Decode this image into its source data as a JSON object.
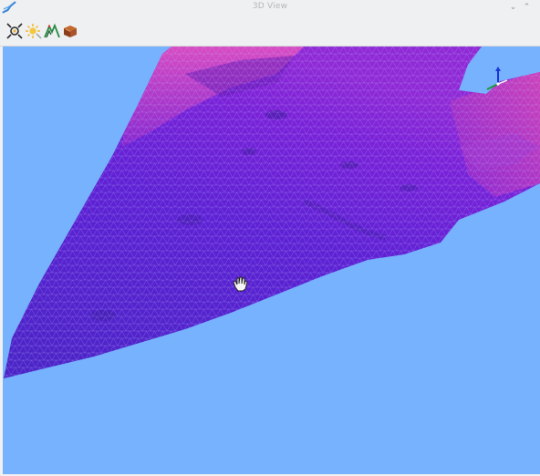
{
  "window": {
    "title": "3D View",
    "app_icon": "terrain-app-icon",
    "controls": {
      "minimize": "⌄",
      "restore": "⌃"
    }
  },
  "toolbar": {
    "buttons": [
      {
        "name": "reset-view-button",
        "icon": "target-crosshair-icon"
      },
      {
        "name": "light-settings-button",
        "icon": "sun-light-icon"
      },
      {
        "name": "terrain-settings-button",
        "icon": "mountain-terrain-icon"
      },
      {
        "name": "export-3d-button",
        "icon": "box-export-icon"
      }
    ]
  },
  "scene": {
    "background_color": "#76b2fd",
    "terrain_colors": {
      "low": "#4e22c8",
      "mid": "#6e24d8",
      "high": "#c040c8",
      "wire": "#c7b8ff"
    },
    "navigation_cursor": "open-hand-icon",
    "axes_gizmo": [
      "x-axis",
      "y-axis",
      "z-axis"
    ]
  }
}
